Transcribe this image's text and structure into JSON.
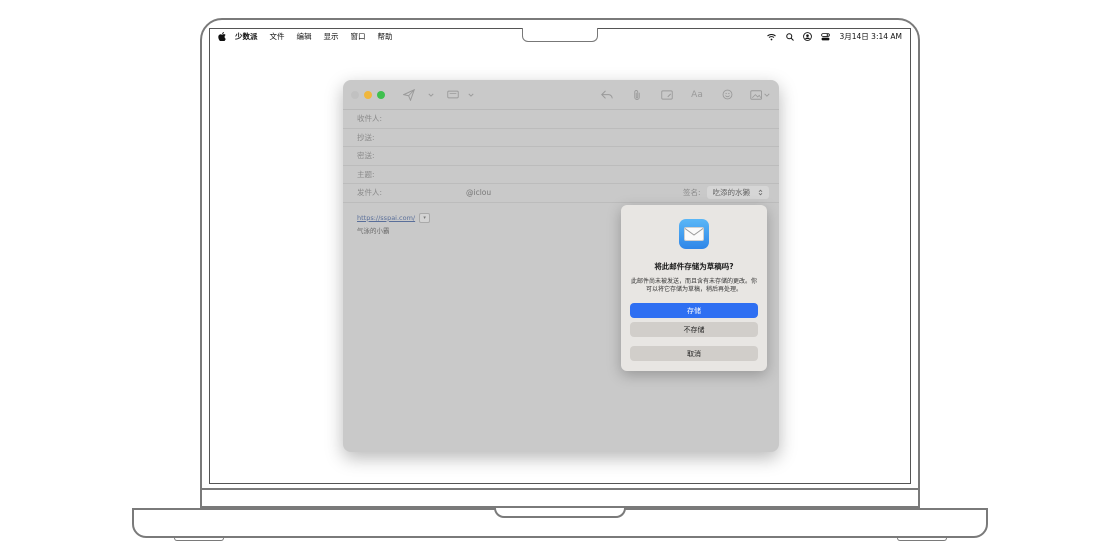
{
  "menubar": {
    "app_name": "少数派",
    "menus": [
      "文件",
      "编辑",
      "显示",
      "窗口",
      "帮助"
    ],
    "clock": "3月14日  3:14 AM",
    "status_icons": [
      "wifi-icon",
      "search-icon",
      "user-account-icon",
      "control-center-icon"
    ]
  },
  "compose": {
    "fields": {
      "to_label": "收件人:",
      "cc_label": "抄送:",
      "bcc_label": "密送:",
      "subject_label": "主题:",
      "from_label": "发件人:",
      "from_value": "@iclou",
      "signature_label": "签名:",
      "signature_value": "吃添的水獭"
    },
    "body": {
      "link": "https://sspai.com/",
      "signature_line": "气泳的小霸"
    }
  },
  "dialog": {
    "title": "将此邮件存储为草稿吗?",
    "message": "此邮件尚未被发送，而且含有未存储的更改。你可以将它存储为草稿，稍后再处理。",
    "save_label": "存储",
    "dont_save_label": "不存储",
    "cancel_label": "取消"
  },
  "colors": {
    "primary_button": "#2e6ff2",
    "traffic_close": "#c1c1c1",
    "traffic_minimize": "#f0b73d",
    "traffic_zoom": "#3fc04f"
  }
}
